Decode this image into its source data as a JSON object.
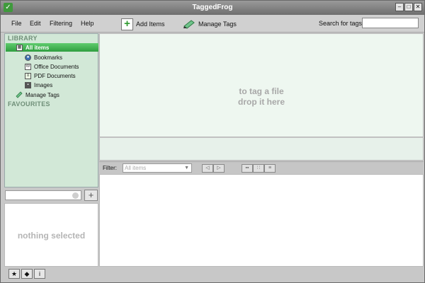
{
  "window": {
    "title": "TaggedFrog"
  },
  "menu": {
    "file": "File",
    "edit": "Edit",
    "filtering": "Filtering",
    "help": "Help"
  },
  "toolbar": {
    "add_items": "Add Items",
    "manage_tags": "Manage Tags"
  },
  "search": {
    "label": "Search for tags",
    "value": ""
  },
  "sidebar": {
    "library_header": "LIBRARY",
    "items": [
      {
        "label": "All items",
        "selected": true
      },
      {
        "label": "Bookmarks"
      },
      {
        "label": "Office Documents"
      },
      {
        "label": "PDF Documents"
      },
      {
        "label": "Images"
      }
    ],
    "manage_tags": "Manage Tags",
    "favourites_header": "FAVOURITES"
  },
  "details": {
    "empty_text": "nothing selected"
  },
  "drop_zone": {
    "line1": "to tag a file",
    "line2": "drop it here"
  },
  "filter": {
    "label": "Filter:",
    "selected": "All items"
  },
  "colors": {
    "accent_green": "#2f9e3f",
    "sidebar_bg": "#d2e8d7",
    "drop_bg": "#eef7f0"
  }
}
